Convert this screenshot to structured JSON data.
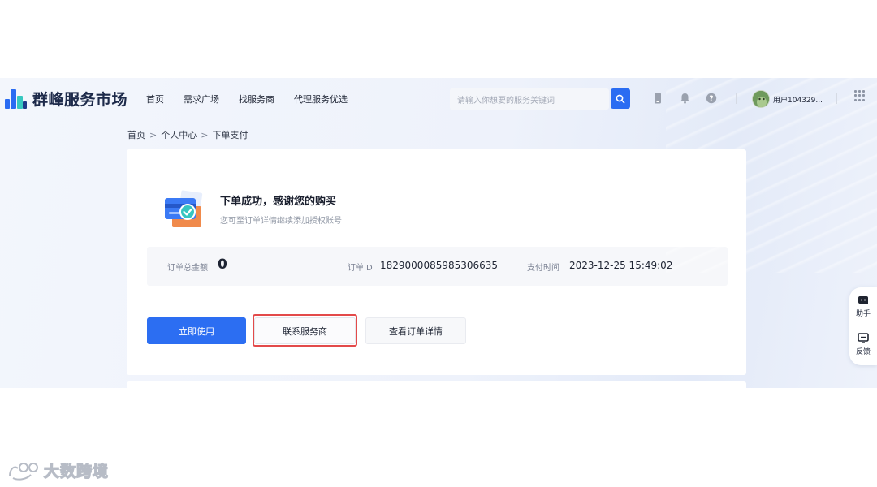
{
  "app": {
    "name": "群峰服务市场"
  },
  "nav": {
    "items": [
      "首页",
      "需求广场",
      "找服务商",
      "代理服务优选"
    ]
  },
  "search": {
    "placeholder": "请输入你想要的服务关键词"
  },
  "user": {
    "name": "用户104329..."
  },
  "breadcrumb": {
    "items": [
      "首页",
      "个人中心",
      "下单支付"
    ],
    "separator": ">"
  },
  "order": {
    "success_title": "下单成功，感谢您的购买",
    "success_subtitle": "您可至订单详情继续添加授权账号",
    "total_label": "订单总金额",
    "total_value": "0",
    "id_label": "订单ID",
    "id_value": "1829000085985306635",
    "pay_time_label": "支付时间",
    "pay_time_value": "2023-12-25 15:49:02"
  },
  "actions": {
    "use_now": "立即使用",
    "contact_provider": "联系服务商",
    "view_details": "查看订单详情"
  },
  "side_panel": {
    "assistant": "助手",
    "feedback": "反馈"
  },
  "watermark": {
    "text": "大数跨境"
  },
  "colors": {
    "primary": "#2c6ef2",
    "highlight": "#e34a4a"
  },
  "icons": [
    "search-icon",
    "mobile-icon",
    "bell-icon",
    "help-icon",
    "apps-grid-icon",
    "assistant-icon",
    "feedback-icon"
  ]
}
